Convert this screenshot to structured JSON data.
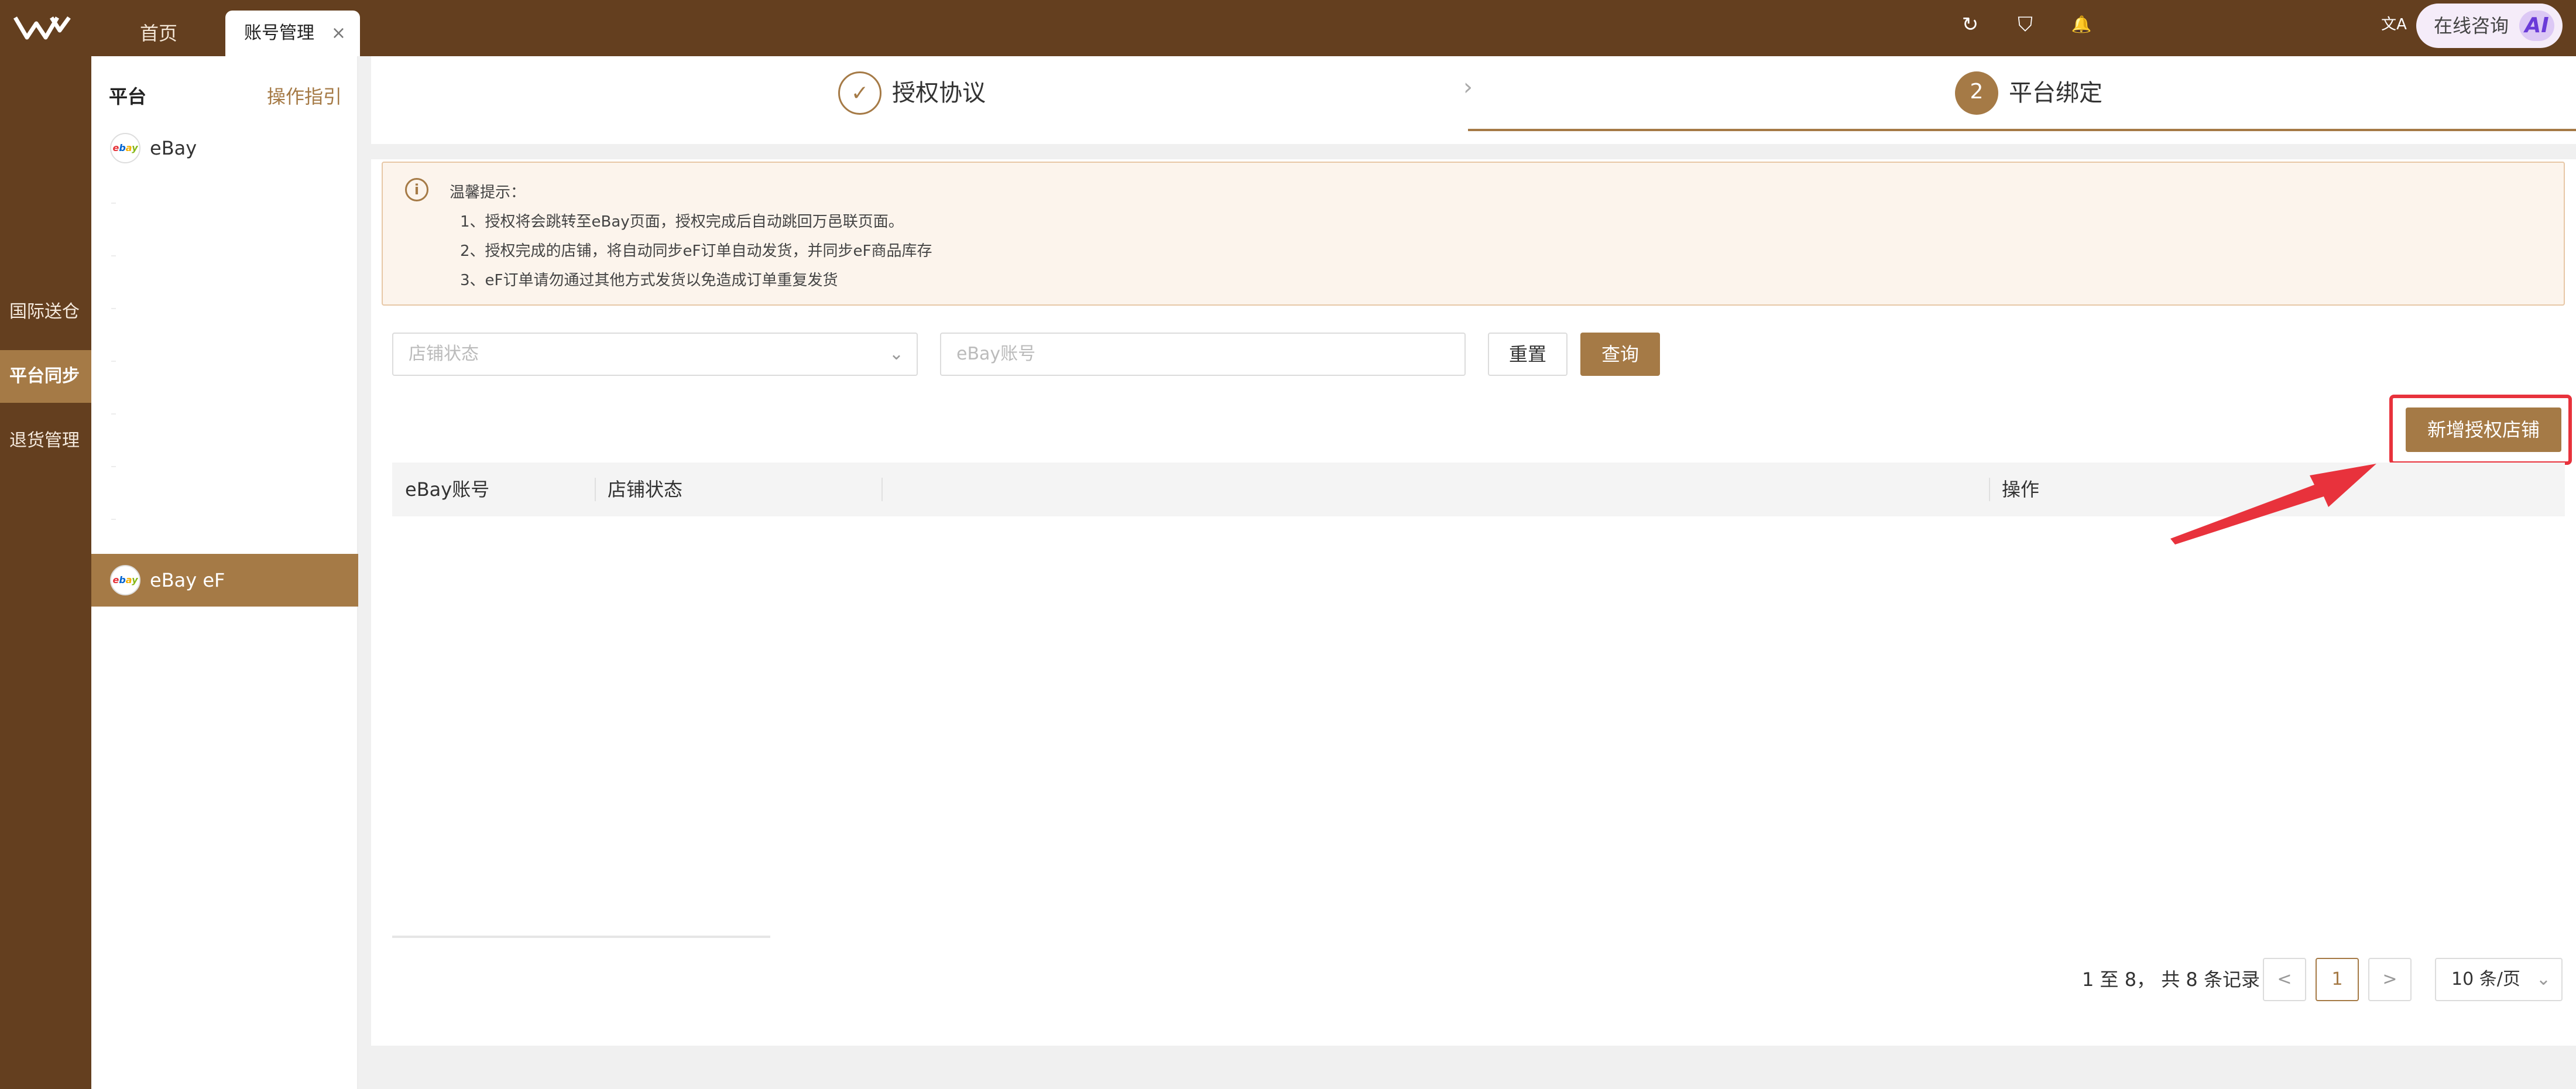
{
  "topbar": {
    "logo_icon": "w-logo-icon",
    "tabs": [
      {
        "label": "首页"
      },
      {
        "label": "账号管理",
        "close": "×"
      }
    ],
    "icons": [
      "refresh-icon",
      "shield-icon",
      "bell-icon",
      "translate-icon"
    ],
    "icon_glyphs": {
      "refresh": "↻",
      "shield": "⛉",
      "bell": "🔔",
      "translate": "文A"
    },
    "consult_label": "在线咨询",
    "ai_badge": "AI"
  },
  "leftnav": {
    "items": [
      {
        "label": "国际送仓",
        "active": false
      },
      {
        "label": "平台同步",
        "active": true
      },
      {
        "label": "退货管理",
        "active": false
      }
    ]
  },
  "side": {
    "header": "平台",
    "guide": "操作指引",
    "platforms": [
      {
        "label": "eBay",
        "logo": "ebay",
        "selected": false
      },
      {
        "label": "eBay eF",
        "logo": "ebay",
        "selected": true
      }
    ]
  },
  "steps": [
    {
      "index": "✓",
      "label": "授权协议",
      "state": "done"
    },
    {
      "index": "2",
      "label": "平台绑定",
      "state": "current"
    }
  ],
  "step_separator": "›",
  "notice": {
    "icon": "info-icon",
    "icon_glyph": "i",
    "title": "温馨提示：",
    "lines": [
      "1、授权将会跳转至eBay页面，授权完成后自动跳回万邑联页面。",
      "2、授权完成的店铺，将自动同步eF订单自动发货，并同步eF商品库存",
      "3、eF订单请勿通过其他方式发货以免造成订单重复发货"
    ]
  },
  "filters": {
    "status_placeholder": "店铺状态",
    "account_placeholder": "eBay账号",
    "chevron": "⌄",
    "reset_label": "重置",
    "query_label": "查询"
  },
  "add_store_label": "新增授权店铺",
  "table": {
    "columns": [
      "eBay账号",
      "店铺状态",
      "",
      "操作"
    ],
    "rows": []
  },
  "pagination": {
    "info": "1 至 8， 共 8 条记录",
    "prev": "<",
    "current": "1",
    "next": ">",
    "page_size": "10 条/页",
    "chevron": "⌄"
  },
  "colors": {
    "brand_dark": "#643f1f",
    "accent": "#a57a46",
    "highlight": "#e8323c"
  }
}
